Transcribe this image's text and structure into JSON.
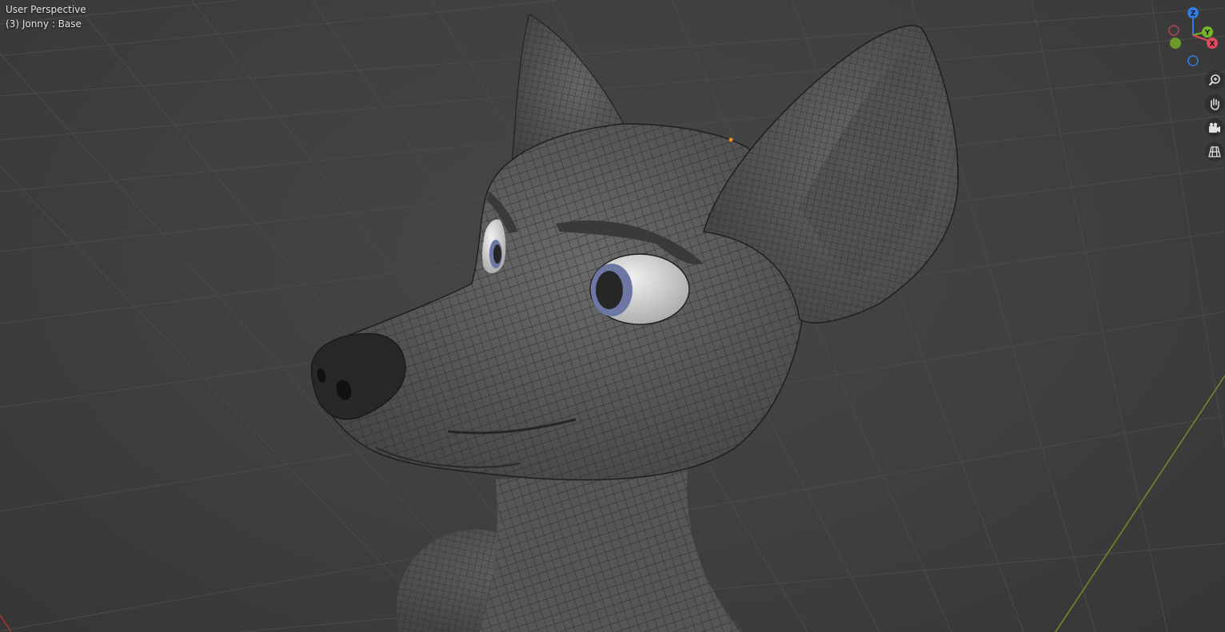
{
  "viewport": {
    "view_name": "User Perspective",
    "object_info": "(3) Jonny : Base"
  },
  "gizmo": {
    "axes": [
      {
        "name": "Z",
        "color": "#2f7de1"
      },
      {
        "name": "Y",
        "color": "#75b52b"
      },
      {
        "name": "X",
        "color": "#e04a5b"
      }
    ]
  },
  "navigation": [
    {
      "name": "zoom",
      "icon": "zoom-icon"
    },
    {
      "name": "pan",
      "icon": "hand-icon"
    },
    {
      "name": "camera",
      "icon": "camera-icon"
    },
    {
      "name": "projection",
      "icon": "grid-projection-icon"
    }
  ],
  "colors": {
    "background": "#3d3d3d",
    "grid": "#4a4a4a",
    "mesh": "#5c5c5c",
    "wireframe": "#2b2b2b",
    "eye_white": "#dcdcdc",
    "iris": "#6d77a3",
    "pupil": "#262626",
    "nose": "#262626",
    "y_axis_line": "#6a8a2c",
    "x_axis_line": "#a03535",
    "origin": "#e8901b"
  }
}
